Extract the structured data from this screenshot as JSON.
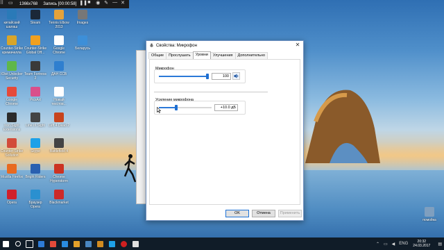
{
  "recording_bar": {
    "resolution": "1366x768",
    "status": "Запись [00:00:58]"
  },
  "desktop_icons": [
    {
      "label": "китайский шалаш",
      "color": "#2a7ab8"
    },
    {
      "label": "Steam",
      "color": "#1b2838"
    },
    {
      "label": "Tennis Elbow 2013",
      "color": "#e5a23a"
    },
    {
      "label": "Images",
      "color": "#777777"
    },
    {
      "label": "Counter-Strike кремачелла",
      "color": "#d8a52a"
    },
    {
      "label": "Counter-Strike Global Off...",
      "color": "#f0a020"
    },
    {
      "label": "Google Chrome",
      "color": "#ffffff"
    },
    {
      "label": "Беларусь",
      "color": "#3d8fd8"
    },
    {
      "label": "IObit Unlocker Security",
      "color": "#5fb74a"
    },
    {
      "label": "Team Fortress 2",
      "color": "#3a3a3a"
    },
    {
      "label": "ДАН ССВ",
      "color": "#2f7fcf"
    },
    {
      "label": "Google Chrome",
      "color": "#e64a3a"
    },
    {
      "label": "PicsArt",
      "color": "#d94f8b"
    },
    {
      "label": "Новый текстов...",
      "color": "#ffffff"
    },
    {
      "label": "Iron Sight Extensions",
      "color": "#2b2b2b"
    },
    {
      "label": "Line of Sight",
      "color": "#444444"
    },
    {
      "label": "Left 4 Dead 2",
      "color": "#c7441e"
    },
    {
      "label": "Counter-Strike Sollution",
      "color": "#d24c3a"
    },
    {
      "label": "Skype",
      "color": "#1ea1e8"
    },
    {
      "label": "Battlefield 4",
      "color": "#444444"
    },
    {
      "label": "Mozilla Firefox",
      "color": "#e86a20"
    },
    {
      "label": "Bright Riders",
      "color": "#2a60b0"
    },
    {
      "label": "Chrome Hyperstorm",
      "color": "#cc3322"
    },
    {
      "label": "Opera",
      "color": "#d0202c"
    },
    {
      "label": "Браузер Opera",
      "color": "#2a90d0"
    },
    {
      "label": "Blackmarket",
      "color": "#cc2a2a"
    },
    {
      "label": "помойка",
      "color": "#7f9fbf"
    }
  ],
  "dialog": {
    "title": "Свойства: Микрофон",
    "close": "✕",
    "tabs": [
      "Общие",
      "Прослушать",
      "Уровни",
      "Улучшения",
      "Дополнительно"
    ],
    "active_tab": "Уровни",
    "microphone": {
      "label": "Микрофон",
      "value": "100",
      "level": 1.0
    },
    "boost": {
      "label": "Усиление микрофона",
      "value": "+10.0 дБ",
      "level": 0.33
    },
    "buttons": {
      "ok": "OK",
      "cancel": "Отмена",
      "apply": "Применить"
    }
  },
  "taskbar": {
    "lang": "ENG",
    "time": "20:32",
    "date": "24.03.2017",
    "items": [
      {
        "name": "start-icon",
        "color": "#ffffff"
      },
      {
        "name": "search-icon",
        "color": "#ffffff"
      },
      {
        "name": "task-view-icon",
        "color": "#ffffff"
      },
      {
        "name": "store-icon",
        "color": "#2e7bd6"
      },
      {
        "name": "chrome-icon",
        "color": "#e24a3a"
      },
      {
        "name": "edge-icon",
        "color": "#2a8be0"
      },
      {
        "name": "media-icon",
        "color": "#e2a02a"
      },
      {
        "name": "steam-icon",
        "color": "#4a86c0"
      },
      {
        "name": "counter-strike-icon",
        "color": "#d08a20"
      },
      {
        "name": "skype-icon",
        "color": "#1ea1e8"
      },
      {
        "name": "record-icon",
        "color": "#d02020"
      },
      {
        "name": "speaker-settings-icon",
        "color": "#e0e0e0"
      }
    ]
  }
}
